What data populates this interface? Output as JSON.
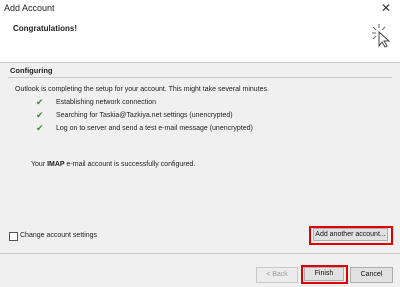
{
  "window": {
    "title": "Add Account"
  },
  "header": {
    "heading": "Congratulations!"
  },
  "configuring": {
    "section_label": "Configuring",
    "intro": "Outlook is completing the setup for your account. This might take several minutes.",
    "steps": [
      {
        "label": "Establishing network connection",
        "status": "done"
      },
      {
        "label": "Searching for Taskia@Tazkiya.net settings (unencrypted)",
        "status": "done"
      },
      {
        "label": "Log on to server and send a test e-mail message (unencrypted)",
        "status": "done"
      }
    ],
    "result_prefix": "Your ",
    "result_protocol": "IMAP",
    "result_suffix": " e-mail account is successfully configured."
  },
  "options": {
    "change_settings_label": "Change account settings",
    "change_settings_checked": false,
    "add_another_label": "Add another account..."
  },
  "footer": {
    "back_label": "< Back",
    "finish_label": "Finish",
    "cancel_label": "Cancel"
  },
  "colors": {
    "highlight": "#e00000",
    "check": "#3a8c3a"
  }
}
